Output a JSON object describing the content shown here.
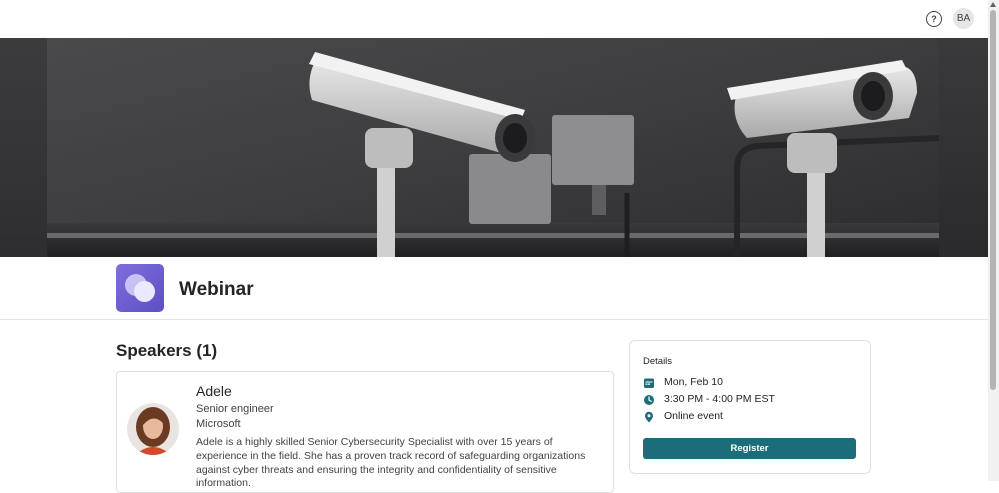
{
  "header": {
    "help_icon": "question-circle-icon",
    "help_glyph": "?",
    "user_initials": "BA"
  },
  "banner": {
    "subject": "security-cameras-photo"
  },
  "event": {
    "title": "Webinar",
    "app_icon": "chat-bubbles-icon",
    "accent_color": "#5b4fc4"
  },
  "speakers": {
    "heading": "Speakers (1)",
    "list": [
      {
        "name": "Adele",
        "role": "Senior engineer",
        "organization": "Microsoft",
        "bio": "Adele is a highly skilled Senior Cybersecurity Specialist with over 15 years of experience in the field. She has a proven track record of safeguarding organizations against cyber threats and ensuring the integrity and confidentiality of sensitive information."
      }
    ]
  },
  "details": {
    "heading": "Details",
    "date": "Mon, Feb 10",
    "time": "3:30 PM - 4:00 PM EST",
    "location": "Online event",
    "register_label": "Register",
    "button_color": "#1a6e7a",
    "icon_color": "#1a6e7a"
  }
}
